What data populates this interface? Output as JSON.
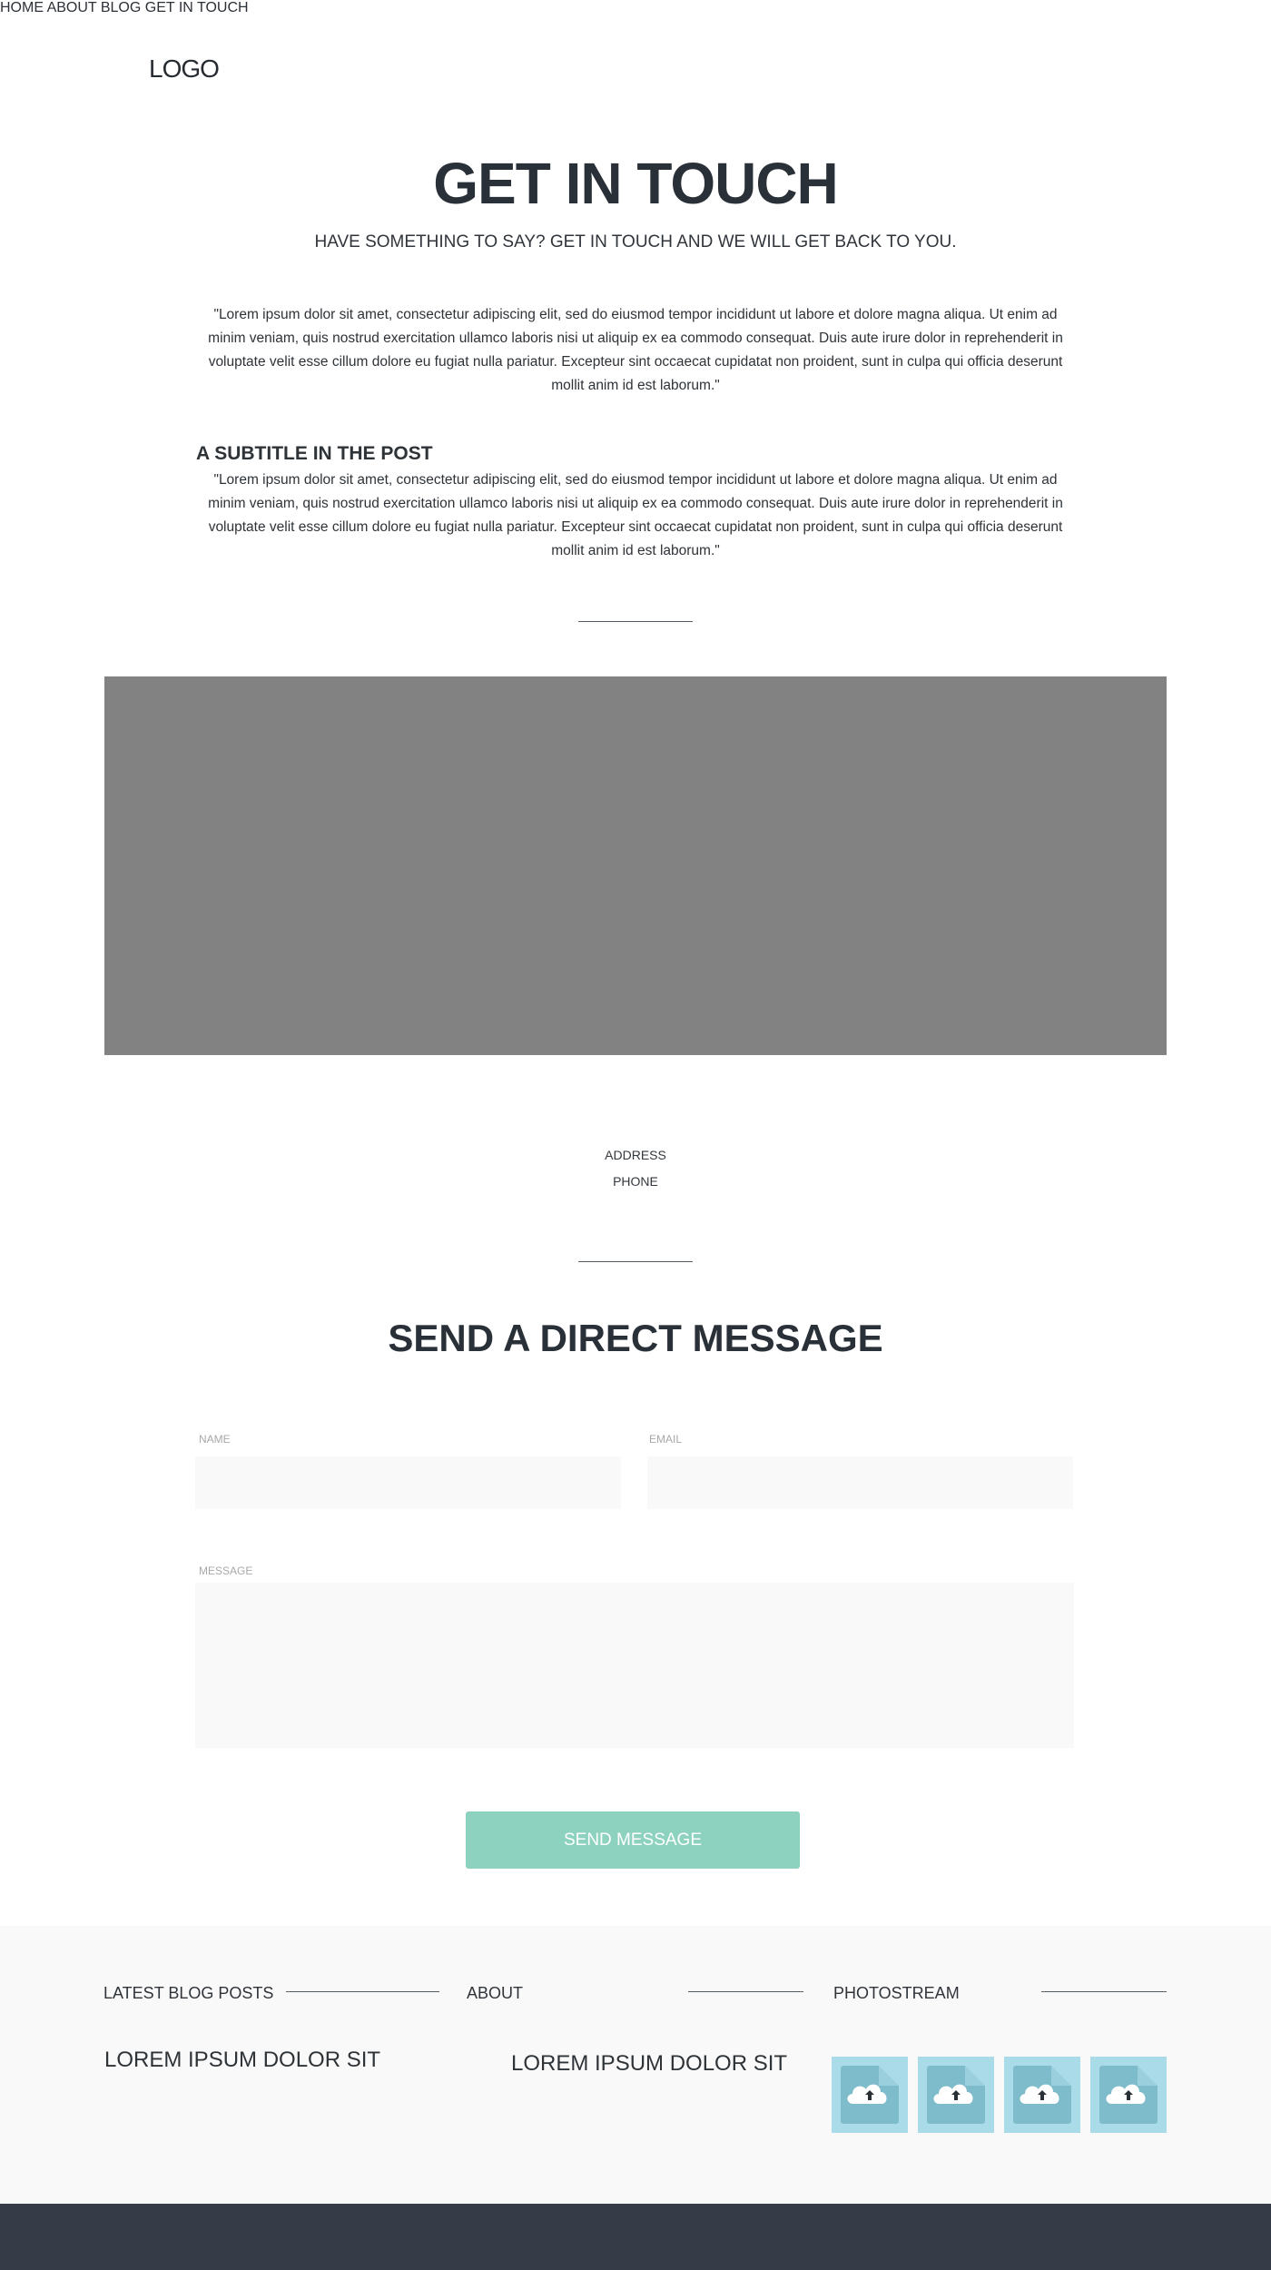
{
  "header": {
    "logo": "LOGO",
    "nav": [
      {
        "label": "HOME"
      },
      {
        "label": "ABOUT"
      },
      {
        "label": "BLOG"
      },
      {
        "label": "GET IN TOUCH"
      }
    ]
  },
  "hero": {
    "title": "GET IN TOUCH",
    "subtitle": "HAVE SOMETHING TO SAY? GET IN TOUCH AND WE WILL GET BACK TO YOU.",
    "paragraph": "\"Lorem ipsum dolor sit amet, consectetur adipiscing elit, sed do eiusmod tempor incididunt ut labore et dolore magna aliqua. Ut enim ad minim veniam, quis nostrud exercitation ullamco laboris nisi ut aliquip ex ea commodo consequat. Duis aute irure dolor in reprehenderit in voluptate velit esse cillum dolore eu fugiat nulla pariatur. Excepteur sint occaecat cupidatat non proident, sunt in culpa qui officia deserunt mollit anim id est laborum.\""
  },
  "post": {
    "subtitle": "A SUBTITLE IN THE POST",
    "paragraph": "\"Lorem ipsum dolor sit amet, consectetur adipiscing elit, sed do eiusmod tempor incididunt ut labore et dolore magna aliqua. Ut enim ad minim veniam, quis nostrud exercitation ullamco laboris nisi ut aliquip ex ea commodo consequat. Duis aute irure dolor in reprehenderit in voluptate velit esse cillum dolore eu fugiat nulla pariatur. Excepteur sint occaecat cupidatat non proident, sunt in culpa qui officia deserunt mollit anim id est laborum.\""
  },
  "contact": {
    "address_label": "ADDRESS",
    "phone_label": "PHONE"
  },
  "form": {
    "title": "SEND A DIRECT MESSAGE",
    "name_label": "NAME",
    "name_value": "",
    "email_label": "EMAIL",
    "email_value": "",
    "message_label": "MESSAGE",
    "message_value": "",
    "submit_label": "SEND MESSAGE"
  },
  "footer": {
    "blog": {
      "heading": "LATEST BLOG POSTS",
      "text": "LOREM IPSUM DOLOR SIT"
    },
    "about": {
      "heading": "ABOUT",
      "text": "LOREM IPSUM DOLOR SIT"
    },
    "photostream": {
      "heading": "PHOTOSTREAM",
      "tiles": [
        "upload-file-icon",
        "upload-file-icon",
        "upload-file-icon",
        "upload-file-icon"
      ]
    }
  },
  "colors": {
    "text_dark": "#2a3038",
    "map_placeholder": "#838283",
    "button": "#8dd2bf",
    "footer_bg": "#f9f9f9",
    "bottom_bar": "#363c47",
    "tile_bg": "#a9dbe8"
  }
}
